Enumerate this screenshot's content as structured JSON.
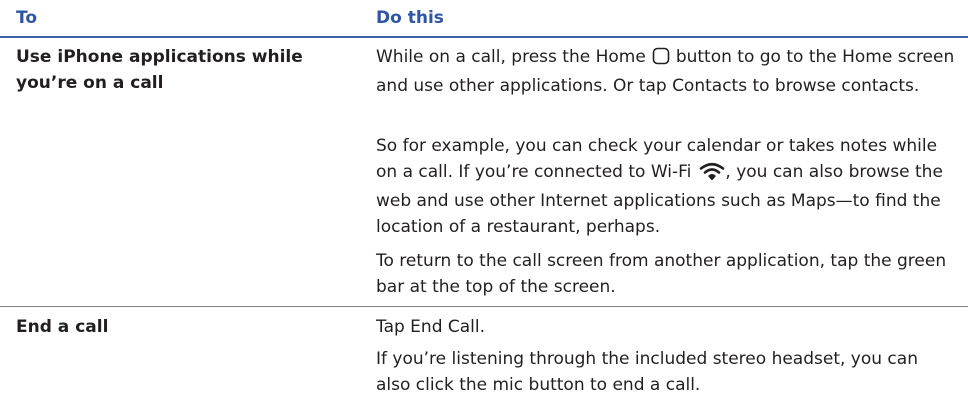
{
  "table": {
    "headers": {
      "to": "To",
      "do_this": "Do this"
    },
    "rows": [
      {
        "label": "Use iPhone applications while you’re on a call",
        "paragraphs": [
          {
            "before": "While on a call, press the Home",
            "icon": "home-button-icon",
            "after": "button to go to the Home screen and use other applications. Or tap Contacts to browse contacts."
          },
          {
            "before": "So for example, you can check your calendar or takes notes while on a call. If you’re connected to Wi-Fi",
            "icon": "wifi-icon",
            "after": ", you can also browse the web and use other Internet applications such as Maps—to find the location of a restaurant, perhaps."
          },
          {
            "text": "To return to the call screen from another application, tap the green bar at the top of the screen."
          }
        ]
      },
      {
        "label": "End a call",
        "paragraphs": [
          {
            "text": "Tap End Call."
          },
          {
            "text": "If you’re listening through the included stereo headset, you can also click the mic button to end a call."
          }
        ]
      }
    ]
  },
  "colors": {
    "header_text": "#2e56a4",
    "header_rule": "#3f60a8",
    "row_rule": "#808080",
    "body_text": "#231f20"
  }
}
